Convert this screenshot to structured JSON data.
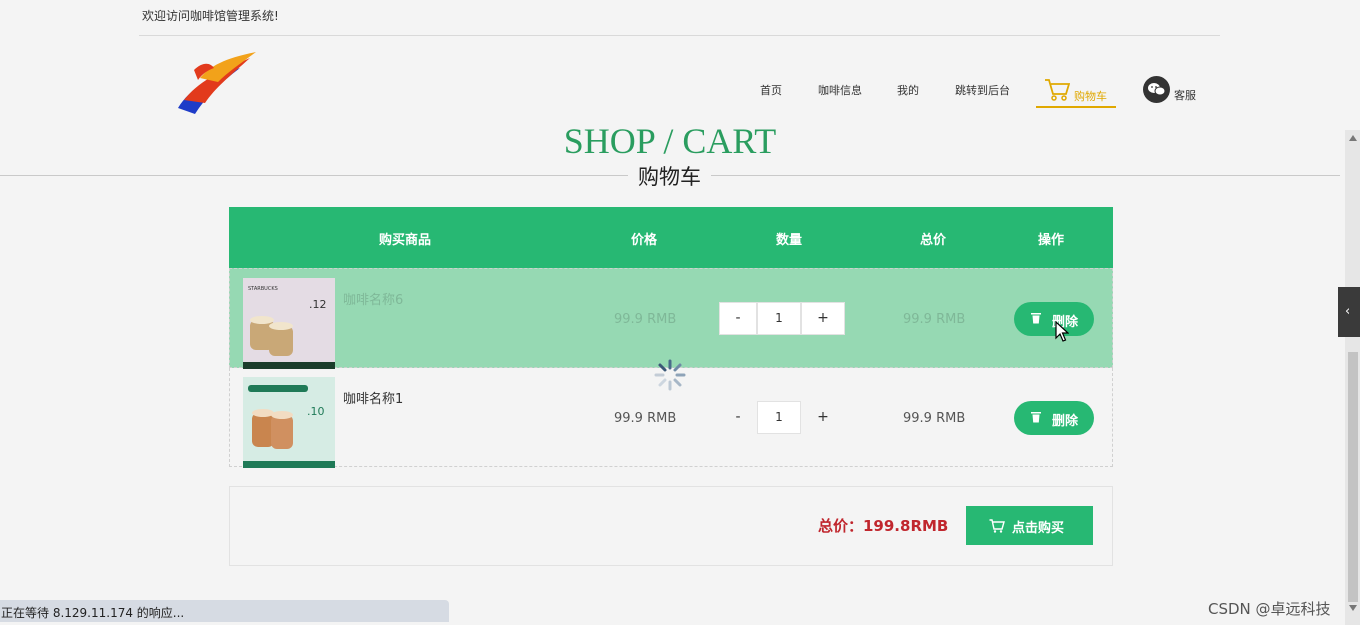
{
  "header": {
    "welcome": "欢迎访问咖啡馆管理系统!"
  },
  "nav": {
    "items": [
      {
        "label": "首页"
      },
      {
        "label": "咖啡信息"
      },
      {
        "label": "我的"
      },
      {
        "label": "跳转到后台"
      }
    ],
    "cart_label": "购物车",
    "service_label": "客服",
    "accent_color": "#e0a800"
  },
  "page": {
    "title_en": "SHOP / CART",
    "title_cn": "购物车"
  },
  "table": {
    "columns": [
      "购买商品",
      "价格",
      "数量",
      "总价",
      "操作"
    ],
    "rows": [
      {
        "name": "咖啡名称6",
        "price": "99.9 RMB",
        "qty": "1",
        "total": "99.9 RMB",
        "action": "删除",
        "minus": "-",
        "plus": "+",
        "thumb_icon": "coffee-product-image",
        "thumb_brand": "STARBUCKS",
        "thumb_number": ".12"
      },
      {
        "name": "咖啡名称1",
        "price": "99.9 RMB",
        "qty": "1",
        "total": "99.9 RMB",
        "action": "删除",
        "minus": "-",
        "plus": "+",
        "thumb_icon": "coffee-product-image",
        "thumb_brand": "",
        "thumb_number": ".10"
      }
    ],
    "header_color": "#27b873",
    "hover_row_color": "#96d9b3"
  },
  "summary": {
    "total_label": "总价：199.8RMB",
    "buy_label": "点击购买"
  },
  "browser": {
    "status": "正在等待 8.129.11.174 的响应...",
    "watermark": "CSDN @卓远科技"
  }
}
